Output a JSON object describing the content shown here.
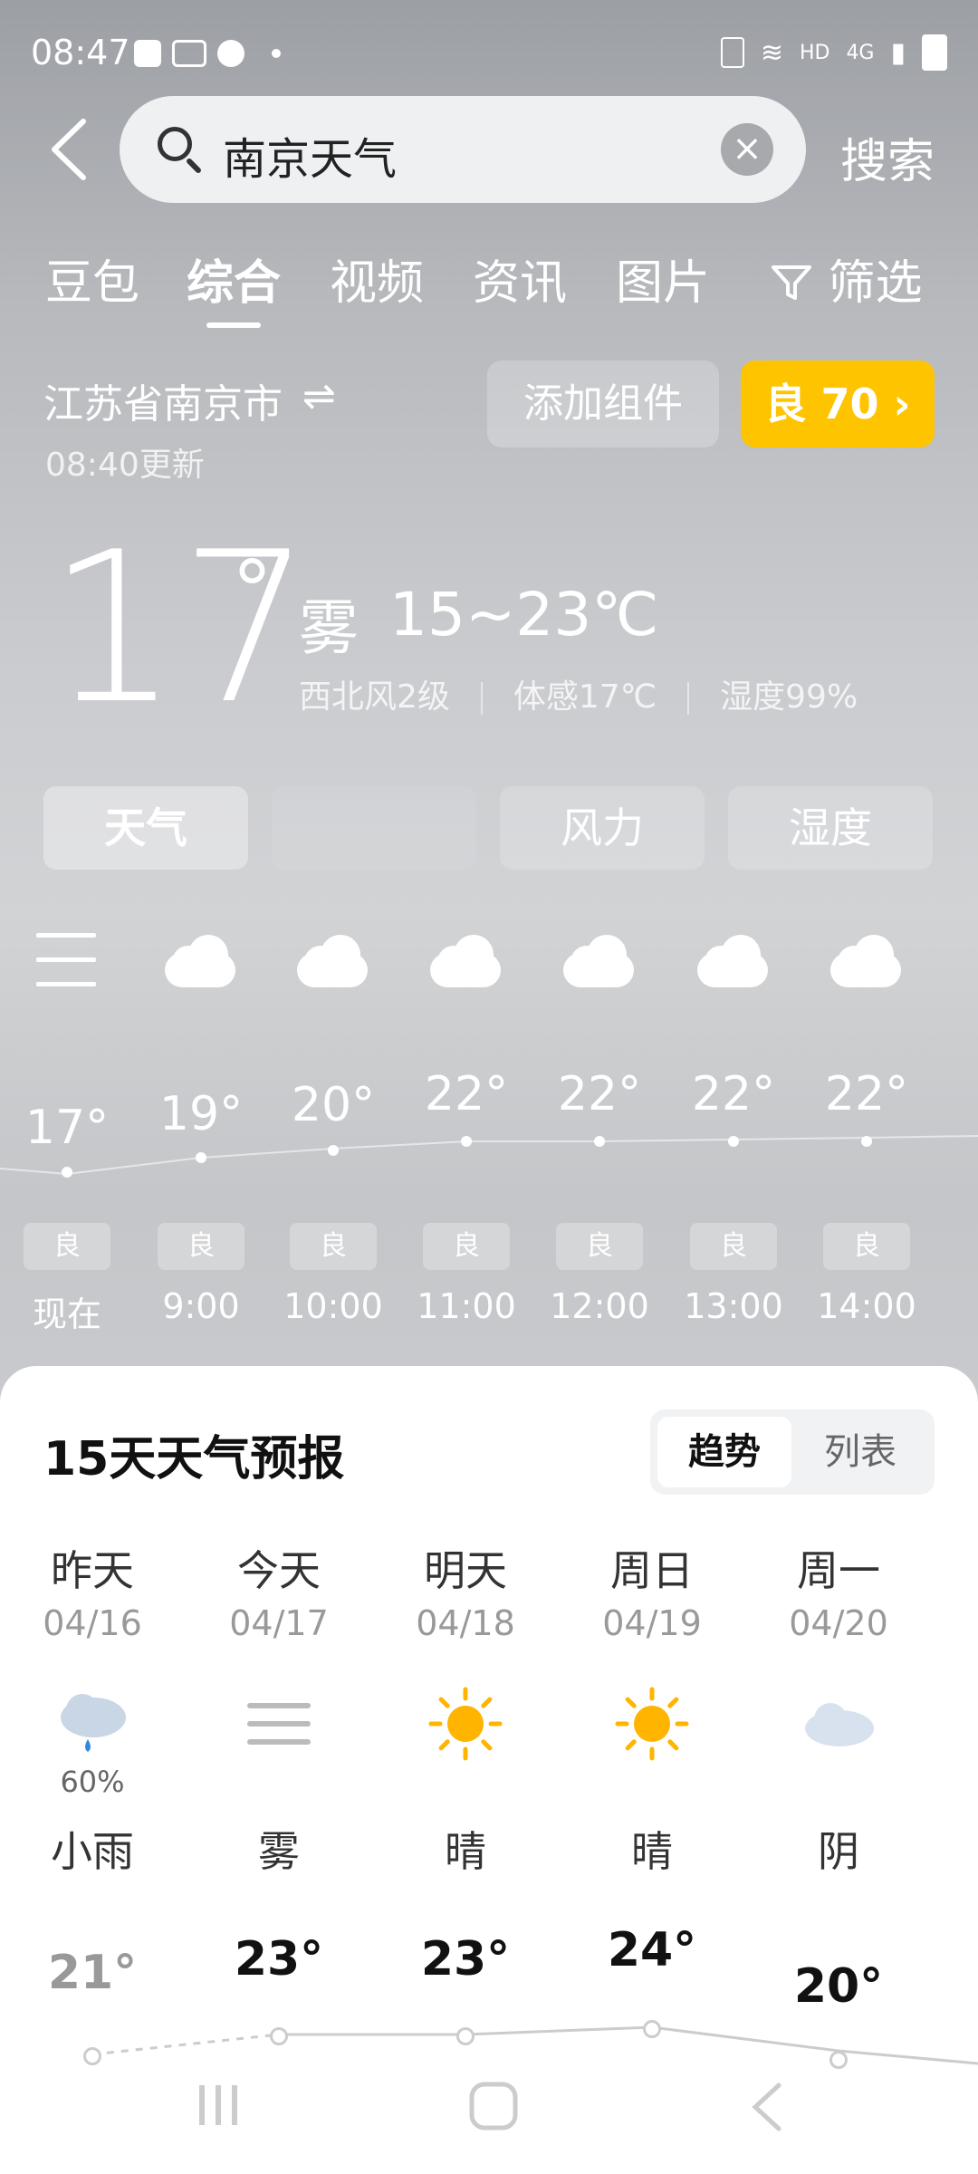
{
  "status_bar": {
    "time": "08:47",
    "network": "4G",
    "hd": "HD"
  },
  "search": {
    "query": "南京天气",
    "button": "搜索"
  },
  "tabs": [
    "豆包",
    "综合",
    "视频",
    "资讯",
    "图片",
    "筛选"
  ],
  "active_tab": "综合",
  "location": {
    "name": "江苏省南京市",
    "updated": "08:40更新"
  },
  "add_widget": "添加组件",
  "aqi": "良 70 ›",
  "current": {
    "temp": "17",
    "deg": "°",
    "condition": "雾",
    "range": "15~23℃",
    "wind": "西北风2级",
    "feels": "体感17℃",
    "humidity": "湿度99%"
  },
  "segments": [
    "天气",
    "",
    "风力",
    "湿度"
  ],
  "hourly": [
    {
      "time": "现在",
      "temp": "17°",
      "aqi": "良"
    },
    {
      "time": "9:00",
      "temp": "19°",
      "aqi": "良"
    },
    {
      "time": "10:00",
      "temp": "20°",
      "aqi": "良"
    },
    {
      "time": "11:00",
      "temp": "22°",
      "aqi": "良"
    },
    {
      "time": "12:00",
      "temp": "22°",
      "aqi": "良"
    },
    {
      "time": "13:00",
      "temp": "22°",
      "aqi": "良"
    },
    {
      "time": "14:00",
      "temp": "22°",
      "aqi": "良"
    }
  ],
  "forecast": {
    "title": "15天天气预报",
    "toggle": [
      "趋势",
      "列表"
    ],
    "days": [
      {
        "name": "昨天",
        "date": "04/16",
        "cond": "小雨",
        "precip": "60%",
        "high": "21°",
        "icon": "rain-icon"
      },
      {
        "name": "今天",
        "date": "04/17",
        "cond": "雾",
        "precip": "",
        "high": "23°",
        "icon": "fog-icon"
      },
      {
        "name": "明天",
        "date": "04/18",
        "cond": "晴",
        "precip": "",
        "high": "23°",
        "icon": "sun-icon"
      },
      {
        "name": "周日",
        "date": "04/19",
        "cond": "晴",
        "precip": "",
        "high": "24°",
        "icon": "sun-icon"
      },
      {
        "name": "周一",
        "date": "04/20",
        "cond": "阴",
        "precip": "",
        "high": "20°",
        "icon": "cloud-icon"
      }
    ]
  }
}
